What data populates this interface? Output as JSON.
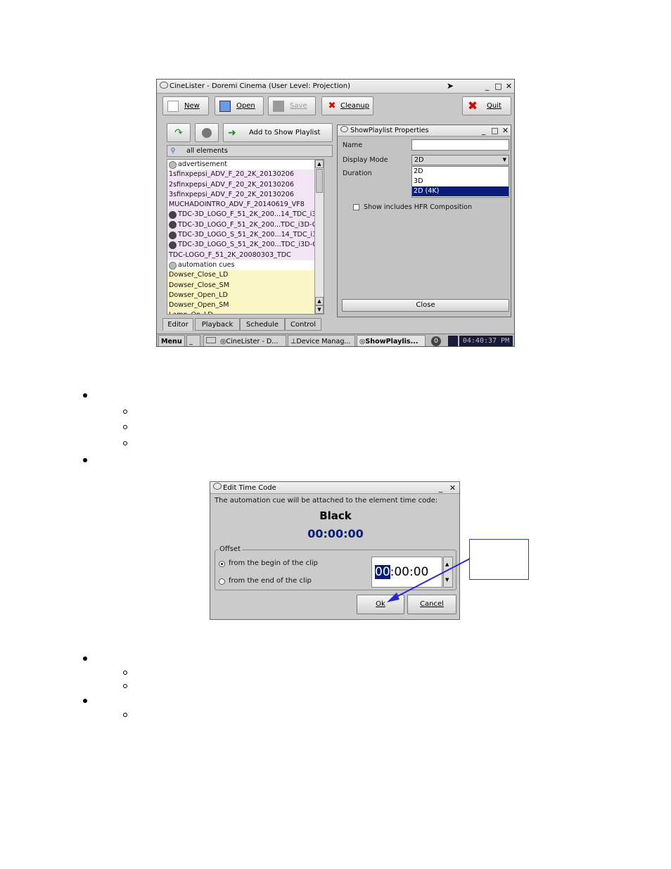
{
  "cinelister": {
    "title": "CineLister - Doremi Cinema (User Level: Projection)",
    "toolbar": {
      "new": "New",
      "open": "Open",
      "save": "Save",
      "cleanup": "Cleanup",
      "quit": "Quit"
    },
    "add_to_playlist": "Add to Show Playlist",
    "filter": "all elements",
    "list": [
      {
        "text": "advertisement",
        "kind": "hdr"
      },
      {
        "text": "1sfinxpepsi_ADV_F_20_2K_20130206",
        "kind": "adv"
      },
      {
        "text": "2sfinxpepsi_ADV_F_20_2K_20130206",
        "kind": "adv"
      },
      {
        "text": "3sfinxpepsi_ADV_F_20_2K_20130206",
        "kind": "adv"
      },
      {
        "text": "MUCHADOINTRO_ADV_F_20140619_VF8",
        "kind": "adv"
      },
      {
        "text": "TDC-3D_LOGO_F_51_2K_200...14_TDC_i3D",
        "kind": "adv3d"
      },
      {
        "text": "TDC-3D_LOGO_F_51_2K_200...TDC_i3D-GB",
        "kind": "adv3d"
      },
      {
        "text": "TDC-3D_LOGO_S_51_2K_200...14_TDC_i3D",
        "kind": "adv3d"
      },
      {
        "text": "TDC-3D_LOGO_S_51_2K_200...TDC_i3D-GB",
        "kind": "adv3d"
      },
      {
        "text": "TDC-LOGO_F_51_2K_20080303_TDC",
        "kind": "adv"
      },
      {
        "text": "automation cues",
        "kind": "hdr"
      },
      {
        "text": "Dowser_Close_LD",
        "kind": "cue"
      },
      {
        "text": "Dowser_Close_SM",
        "kind": "cue"
      },
      {
        "text": "Dowser_Open_LD",
        "kind": "cue"
      },
      {
        "text": "Dowser_Open_SM",
        "kind": "cue"
      },
      {
        "text": "Lamp_On_LD",
        "kind": "cue"
      }
    ],
    "tabs": [
      "Editor",
      "Playback",
      "Schedule",
      "Control"
    ],
    "taskbar": {
      "menu": "Menu",
      "items": [
        "CineLister - D...",
        "Device Manag...",
        "ShowPlaylis..."
      ],
      "badge": "0",
      "clock": "04:40:37 PM"
    },
    "spp": {
      "title": "ShowPlaylist Properties",
      "name_label": "Name",
      "name_value": "",
      "mode_label": "Display Mode",
      "mode_value": "2D",
      "duration_label": "Duration",
      "options": [
        "2D",
        "3D",
        "2D (4K)"
      ],
      "hfr_label": "Show includes HFR Composition",
      "close": "Close"
    }
  },
  "edit_time_code": {
    "title": "Edit Time Code",
    "message": "The automation cue will be attached to the element time code:",
    "element": "Black",
    "timecode": "00:00:00",
    "offset_label": "Offset",
    "opt_begin": "from the begin of the clip",
    "opt_end": "from the end of the clip",
    "field_hl": "00",
    "field_rest": ":00:00",
    "ok": "Ok",
    "cancel": "Cancel"
  },
  "colors": {
    "selection": "#0a1e78",
    "timecode": "#0a1e78",
    "arrow": "#2a2ad0"
  }
}
